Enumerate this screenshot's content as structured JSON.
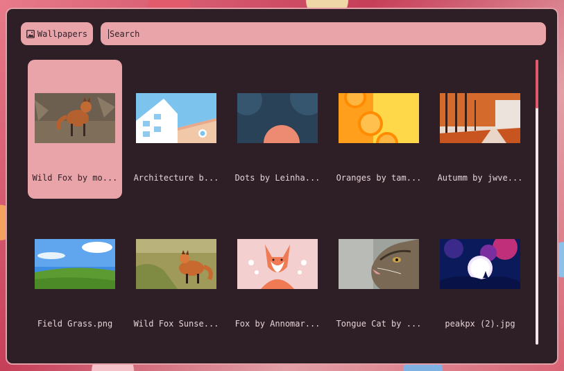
{
  "toolbar": {
    "wallpapers_label": "Wallpapers",
    "search_placeholder": "Search",
    "icon": "image-icon"
  },
  "wallpapers": [
    {
      "label": "Wild Fox by mo...",
      "selected": true
    },
    {
      "label": "Architecture b...",
      "selected": false
    },
    {
      "label": "Dots by Leinha...",
      "selected": false
    },
    {
      "label": "Oranges by tam...",
      "selected": false
    },
    {
      "label": "Autumm by jwve...",
      "selected": false
    },
    {
      "label": "Field Grass.png",
      "selected": false
    },
    {
      "label": "Wild Fox Sunse...",
      "selected": false
    },
    {
      "label": "Fox by Annomar...",
      "selected": false
    },
    {
      "label": "Tongue Cat by ...",
      "selected": false
    },
    {
      "label": "peakpx (2).jpg",
      "selected": false
    }
  ],
  "colors": {
    "window_bg": "#2e1f26",
    "accent": "#e9a4aa",
    "scroll_thumb": "#e25b6c"
  }
}
